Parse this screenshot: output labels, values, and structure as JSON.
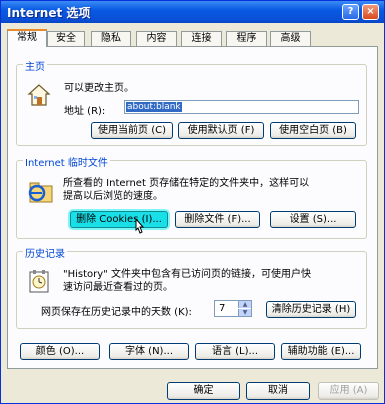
{
  "window": {
    "title": "Internet 选项",
    "help_label": "?",
    "close_label": "×"
  },
  "tabs": [
    {
      "label": "常规",
      "active": true
    },
    {
      "label": "安全"
    },
    {
      "label": "隐私"
    },
    {
      "label": "内容"
    },
    {
      "label": "连接"
    },
    {
      "label": "程序"
    },
    {
      "label": "高级"
    }
  ],
  "home": {
    "group_label": "主页",
    "description": "可以更改主页。",
    "address_label": "地址 (R):",
    "address_value": "about:blank",
    "use_current": "使用当前页 (C)",
    "use_default": "使用默认页 (F)",
    "use_blank": "使用空白页 (B)"
  },
  "temp_files": {
    "group_label": "Internet 临时文件",
    "description_line1": "所查看的 Internet 页存储在特定的文件夹中，这样可以",
    "description_line2": "提高以后浏览的速度。",
    "delete_cookies": "删除 Cookies (I)...",
    "delete_files": "删除文件 (F)...",
    "settings": "设置 (S)..."
  },
  "history": {
    "group_label": "历史记录",
    "description_line1": "\"History\" 文件夹中包含有已访问页的链接，可使用户快",
    "description_line2": "速访问最近查看过的页。",
    "days_label": "网页保存在历史记录中的天数 (K):",
    "days_value": "7",
    "clear_history": "清除历史记录 (H)"
  },
  "bottom_buttons": {
    "colors": "颜色 (O)...",
    "fonts": "字体 (N)...",
    "languages": "语言 (L)...",
    "accessibility": "辅助功能 (E)..."
  },
  "dialog_buttons": {
    "ok": "确定",
    "cancel": "取消",
    "apply": "应用 (A)"
  },
  "colors": {
    "title_bar": "#0a5ae3",
    "group_label": "#0046d5",
    "highlight_button": "#19e0e8",
    "dialog_bg": "#ece9d8"
  }
}
